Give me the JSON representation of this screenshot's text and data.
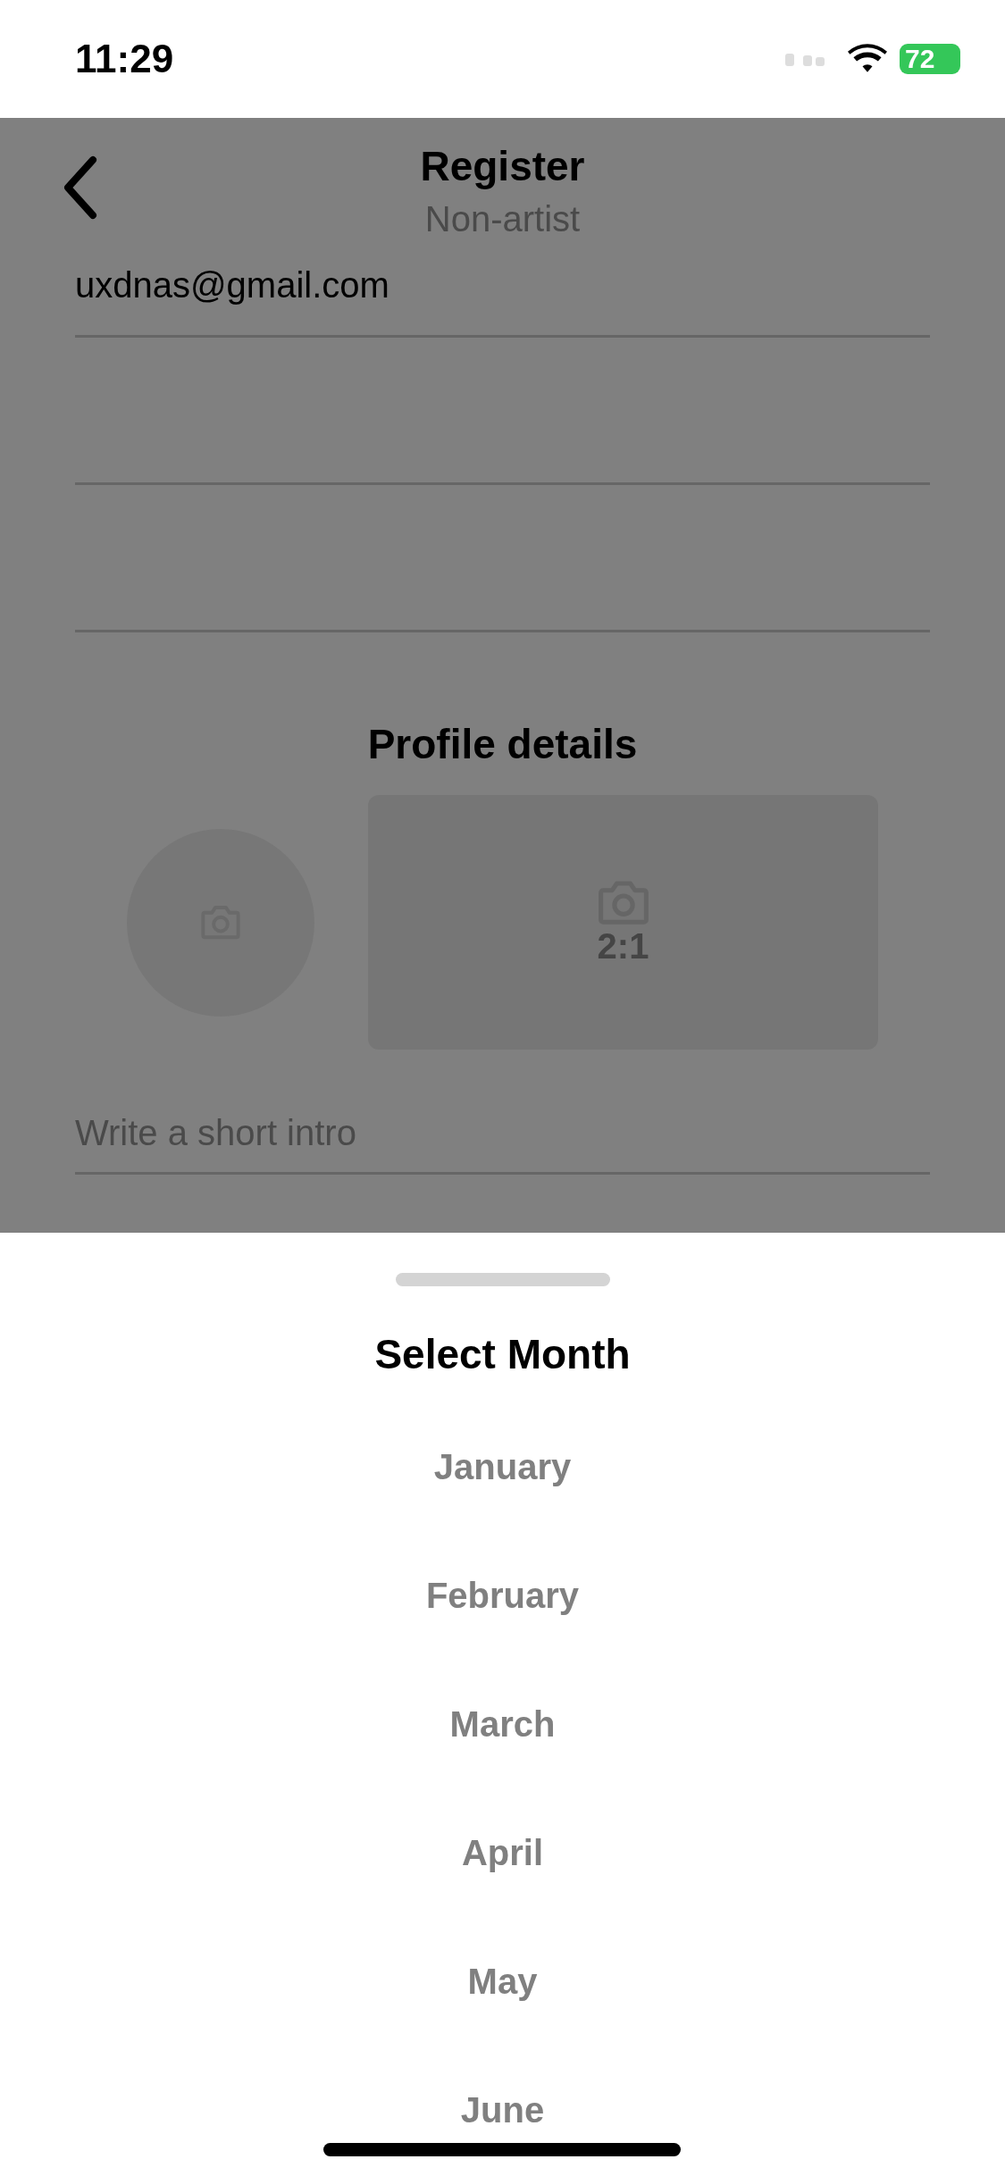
{
  "status_bar": {
    "time": "11:29",
    "battery": "72"
  },
  "header": {
    "title": "Register",
    "subtitle": "Non-artist"
  },
  "email_field": {
    "value": "uxdnas@gmail.com"
  },
  "profile": {
    "heading": "Profile details",
    "cover_ratio": "2:1",
    "intro_placeholder": "Write a short intro"
  },
  "sheet": {
    "title": "Select Month",
    "months": [
      "January",
      "February",
      "March",
      "April",
      "May",
      "June"
    ]
  }
}
